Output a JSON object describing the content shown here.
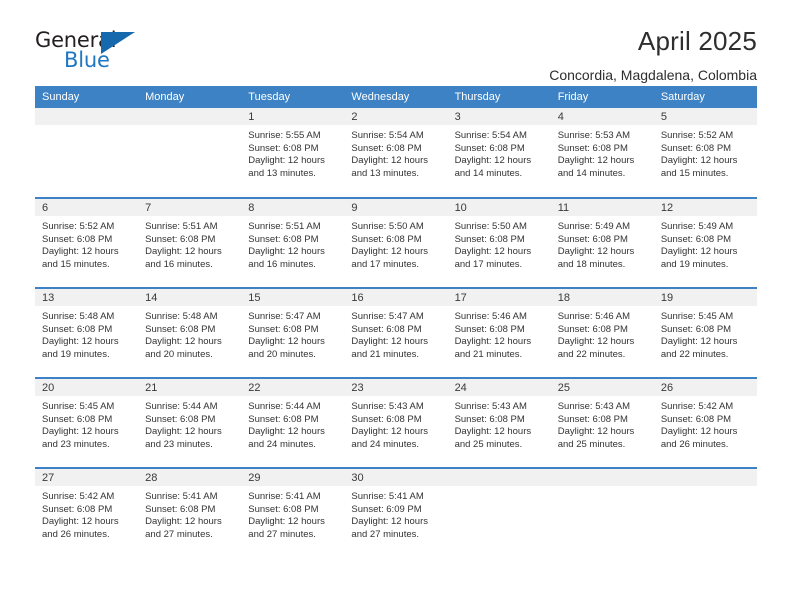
{
  "brand": {
    "name_part1": "General",
    "name_part2": "Blue",
    "triangle_icon": "triangle-icon",
    "accent_color": "#1f77c2"
  },
  "header": {
    "title": "April 2025",
    "subtitle": "Concordia, Magdalena, Colombia"
  },
  "calendar": {
    "header_color": "#3c82c4",
    "daynum_band_color": "#f1f1f1",
    "weekday_headers": [
      "Sunday",
      "Monday",
      "Tuesday",
      "Wednesday",
      "Thursday",
      "Friday",
      "Saturday"
    ],
    "weeks": [
      [
        {
          "day": "",
          "sunrise": "",
          "sunset": "",
          "daylight_line1": "",
          "daylight_line2": ""
        },
        {
          "day": "",
          "sunrise": "",
          "sunset": "",
          "daylight_line1": "",
          "daylight_line2": ""
        },
        {
          "day": "1",
          "sunrise": "Sunrise: 5:55 AM",
          "sunset": "Sunset: 6:08 PM",
          "daylight_line1": "Daylight: 12 hours",
          "daylight_line2": "and 13 minutes."
        },
        {
          "day": "2",
          "sunrise": "Sunrise: 5:54 AM",
          "sunset": "Sunset: 6:08 PM",
          "daylight_line1": "Daylight: 12 hours",
          "daylight_line2": "and 13 minutes."
        },
        {
          "day": "3",
          "sunrise": "Sunrise: 5:54 AM",
          "sunset": "Sunset: 6:08 PM",
          "daylight_line1": "Daylight: 12 hours",
          "daylight_line2": "and 14 minutes."
        },
        {
          "day": "4",
          "sunrise": "Sunrise: 5:53 AM",
          "sunset": "Sunset: 6:08 PM",
          "daylight_line1": "Daylight: 12 hours",
          "daylight_line2": "and 14 minutes."
        },
        {
          "day": "5",
          "sunrise": "Sunrise: 5:52 AM",
          "sunset": "Sunset: 6:08 PM",
          "daylight_line1": "Daylight: 12 hours",
          "daylight_line2": "and 15 minutes."
        }
      ],
      [
        {
          "day": "6",
          "sunrise": "Sunrise: 5:52 AM",
          "sunset": "Sunset: 6:08 PM",
          "daylight_line1": "Daylight: 12 hours",
          "daylight_line2": "and 15 minutes."
        },
        {
          "day": "7",
          "sunrise": "Sunrise: 5:51 AM",
          "sunset": "Sunset: 6:08 PM",
          "daylight_line1": "Daylight: 12 hours",
          "daylight_line2": "and 16 minutes."
        },
        {
          "day": "8",
          "sunrise": "Sunrise: 5:51 AM",
          "sunset": "Sunset: 6:08 PM",
          "daylight_line1": "Daylight: 12 hours",
          "daylight_line2": "and 16 minutes."
        },
        {
          "day": "9",
          "sunrise": "Sunrise: 5:50 AM",
          "sunset": "Sunset: 6:08 PM",
          "daylight_line1": "Daylight: 12 hours",
          "daylight_line2": "and 17 minutes."
        },
        {
          "day": "10",
          "sunrise": "Sunrise: 5:50 AM",
          "sunset": "Sunset: 6:08 PM",
          "daylight_line1": "Daylight: 12 hours",
          "daylight_line2": "and 17 minutes."
        },
        {
          "day": "11",
          "sunrise": "Sunrise: 5:49 AM",
          "sunset": "Sunset: 6:08 PM",
          "daylight_line1": "Daylight: 12 hours",
          "daylight_line2": "and 18 minutes."
        },
        {
          "day": "12",
          "sunrise": "Sunrise: 5:49 AM",
          "sunset": "Sunset: 6:08 PM",
          "daylight_line1": "Daylight: 12 hours",
          "daylight_line2": "and 19 minutes."
        }
      ],
      [
        {
          "day": "13",
          "sunrise": "Sunrise: 5:48 AM",
          "sunset": "Sunset: 6:08 PM",
          "daylight_line1": "Daylight: 12 hours",
          "daylight_line2": "and 19 minutes."
        },
        {
          "day": "14",
          "sunrise": "Sunrise: 5:48 AM",
          "sunset": "Sunset: 6:08 PM",
          "daylight_line1": "Daylight: 12 hours",
          "daylight_line2": "and 20 minutes."
        },
        {
          "day": "15",
          "sunrise": "Sunrise: 5:47 AM",
          "sunset": "Sunset: 6:08 PM",
          "daylight_line1": "Daylight: 12 hours",
          "daylight_line2": "and 20 minutes."
        },
        {
          "day": "16",
          "sunrise": "Sunrise: 5:47 AM",
          "sunset": "Sunset: 6:08 PM",
          "daylight_line1": "Daylight: 12 hours",
          "daylight_line2": "and 21 minutes."
        },
        {
          "day": "17",
          "sunrise": "Sunrise: 5:46 AM",
          "sunset": "Sunset: 6:08 PM",
          "daylight_line1": "Daylight: 12 hours",
          "daylight_line2": "and 21 minutes."
        },
        {
          "day": "18",
          "sunrise": "Sunrise: 5:46 AM",
          "sunset": "Sunset: 6:08 PM",
          "daylight_line1": "Daylight: 12 hours",
          "daylight_line2": "and 22 minutes."
        },
        {
          "day": "19",
          "sunrise": "Sunrise: 5:45 AM",
          "sunset": "Sunset: 6:08 PM",
          "daylight_line1": "Daylight: 12 hours",
          "daylight_line2": "and 22 minutes."
        }
      ],
      [
        {
          "day": "20",
          "sunrise": "Sunrise: 5:45 AM",
          "sunset": "Sunset: 6:08 PM",
          "daylight_line1": "Daylight: 12 hours",
          "daylight_line2": "and 23 minutes."
        },
        {
          "day": "21",
          "sunrise": "Sunrise: 5:44 AM",
          "sunset": "Sunset: 6:08 PM",
          "daylight_line1": "Daylight: 12 hours",
          "daylight_line2": "and 23 minutes."
        },
        {
          "day": "22",
          "sunrise": "Sunrise: 5:44 AM",
          "sunset": "Sunset: 6:08 PM",
          "daylight_line1": "Daylight: 12 hours",
          "daylight_line2": "and 24 minutes."
        },
        {
          "day": "23",
          "sunrise": "Sunrise: 5:43 AM",
          "sunset": "Sunset: 6:08 PM",
          "daylight_line1": "Daylight: 12 hours",
          "daylight_line2": "and 24 minutes."
        },
        {
          "day": "24",
          "sunrise": "Sunrise: 5:43 AM",
          "sunset": "Sunset: 6:08 PM",
          "daylight_line1": "Daylight: 12 hours",
          "daylight_line2": "and 25 minutes."
        },
        {
          "day": "25",
          "sunrise": "Sunrise: 5:43 AM",
          "sunset": "Sunset: 6:08 PM",
          "daylight_line1": "Daylight: 12 hours",
          "daylight_line2": "and 25 minutes."
        },
        {
          "day": "26",
          "sunrise": "Sunrise: 5:42 AM",
          "sunset": "Sunset: 6:08 PM",
          "daylight_line1": "Daylight: 12 hours",
          "daylight_line2": "and 26 minutes."
        }
      ],
      [
        {
          "day": "27",
          "sunrise": "Sunrise: 5:42 AM",
          "sunset": "Sunset: 6:08 PM",
          "daylight_line1": "Daylight: 12 hours",
          "daylight_line2": "and 26 minutes."
        },
        {
          "day": "28",
          "sunrise": "Sunrise: 5:41 AM",
          "sunset": "Sunset: 6:08 PM",
          "daylight_line1": "Daylight: 12 hours",
          "daylight_line2": "and 27 minutes."
        },
        {
          "day": "29",
          "sunrise": "Sunrise: 5:41 AM",
          "sunset": "Sunset: 6:08 PM",
          "daylight_line1": "Daylight: 12 hours",
          "daylight_line2": "and 27 minutes."
        },
        {
          "day": "30",
          "sunrise": "Sunrise: 5:41 AM",
          "sunset": "Sunset: 6:09 PM",
          "daylight_line1": "Daylight: 12 hours",
          "daylight_line2": "and 27 minutes."
        },
        {
          "day": "",
          "sunrise": "",
          "sunset": "",
          "daylight_line1": "",
          "daylight_line2": ""
        },
        {
          "day": "",
          "sunrise": "",
          "sunset": "",
          "daylight_line1": "",
          "daylight_line2": ""
        },
        {
          "day": "",
          "sunrise": "",
          "sunset": "",
          "daylight_line1": "",
          "daylight_line2": ""
        }
      ]
    ]
  }
}
